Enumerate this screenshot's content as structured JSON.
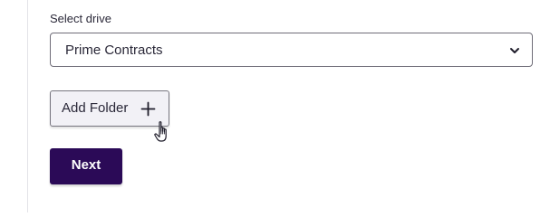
{
  "form": {
    "drive_label": "Select drive",
    "drive_select": {
      "selected": "Prime Contracts",
      "icon": "chevron-down-icon"
    },
    "add_folder_button": {
      "label": "Add Folder",
      "icon": "plus-icon"
    },
    "next_button": {
      "label": "Next"
    }
  },
  "cursor": {
    "icon": "hand-pointer-icon"
  },
  "colors": {
    "primary": "#2b0a57",
    "text": "#2a2838",
    "border": "#6f6d78",
    "secondary_button_bg": "#f2f1f6"
  }
}
